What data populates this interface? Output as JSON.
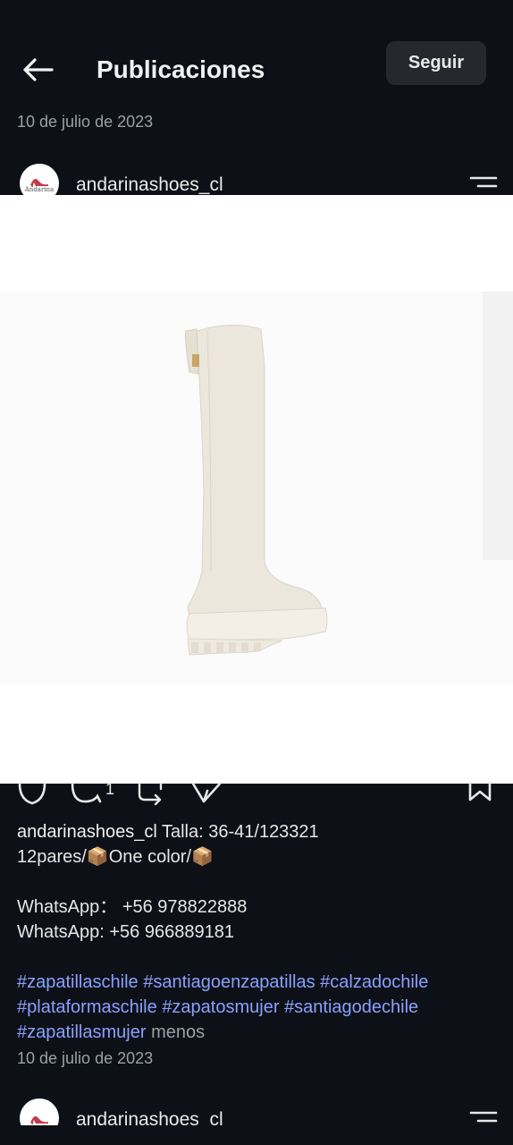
{
  "header": {
    "title": "Publicaciones",
    "follow_label": "Seguir"
  },
  "post1": {
    "date": "10 de julio de 2023",
    "username": "andarinashoes_cl",
    "avatar_text": "Andarina",
    "comment_count": "1",
    "caption": {
      "username": "andarinashoes_cl",
      "line1": "Talla: 36-41/123321",
      "line2_pre": "12pares/",
      "line2_mid": "One color/",
      "whatsapp1": "WhatsApp： +56 978822888",
      "whatsapp2": "WhatsApp: +56 966889181",
      "hashtags": [
        "#zapatillaschile",
        "#santiagoenzapatillas",
        "#calzadochile",
        "#plataformaschile",
        "#zapatosmujer",
        "#santiagodechile",
        "#zapatillasmujer"
      ],
      "more_label": "menos"
    },
    "caption_date": "10 de julio de 2023"
  },
  "post2": {
    "username": "andarinashoes_cl"
  },
  "colors": {
    "background": "#0d1117",
    "hashtag": "#8aa0ff",
    "button_bg": "#25282d"
  }
}
